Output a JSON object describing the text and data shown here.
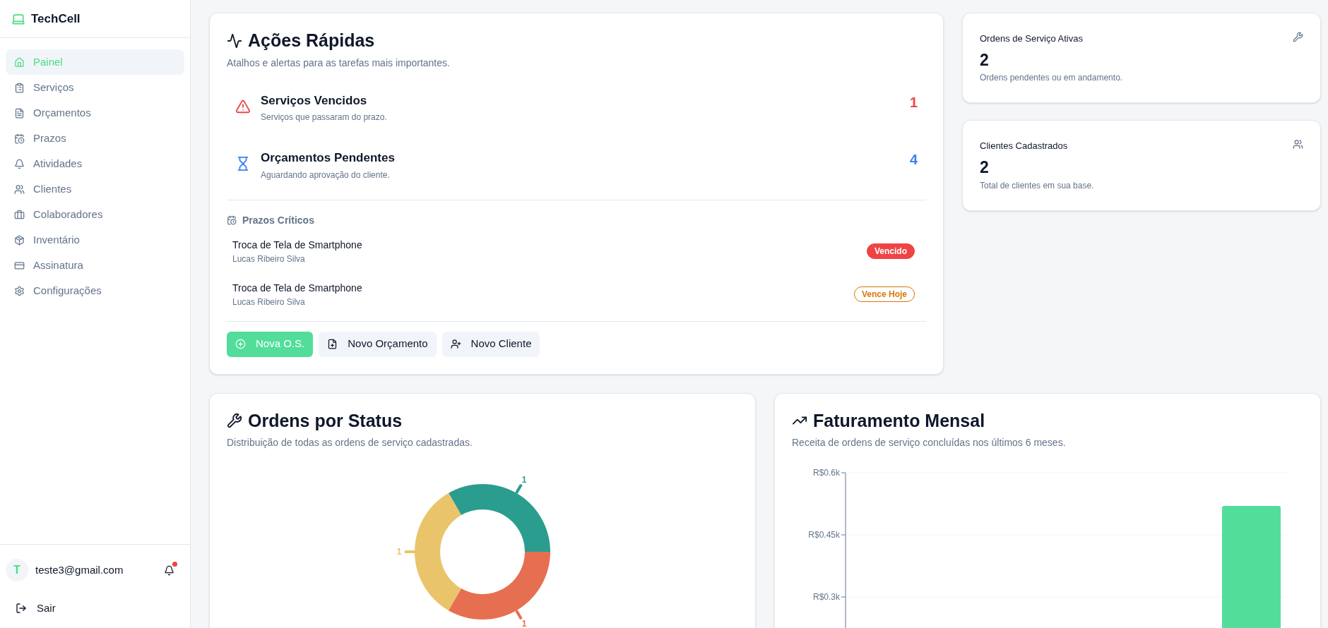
{
  "sidebar": {
    "brand": "TechCell",
    "items": [
      {
        "label": "Painel",
        "selected": true
      },
      {
        "label": "Serviços",
        "selected": false
      },
      {
        "label": "Orçamentos",
        "selected": false
      },
      {
        "label": "Prazos",
        "selected": false
      },
      {
        "label": "Atividades",
        "selected": false
      },
      {
        "label": "Clientes",
        "selected": false
      },
      {
        "label": "Colaboradores",
        "selected": false
      },
      {
        "label": "Inventário",
        "selected": false
      },
      {
        "label": "Assinatura",
        "selected": false
      },
      {
        "label": "Configurações",
        "selected": false
      }
    ],
    "user": {
      "initial": "T",
      "email": "teste3@gmail.com",
      "has_notification": true
    },
    "logout": "Sair"
  },
  "quick_actions": {
    "title": "Ações Rápidas",
    "subtitle": "Atalhos e alertas para as tarefas mais importantes.",
    "alerts": [
      {
        "kind": "danger",
        "title": "Serviços Vencidos",
        "description": "Serviços que passaram do prazo.",
        "count": "1"
      },
      {
        "kind": "info",
        "title": "Orçamentos Pendentes",
        "description": "Aguardando aprovação do cliente.",
        "count": "4"
      }
    ],
    "deadlines": {
      "title": "Prazos Críticos",
      "items": [
        {
          "service": "Troca de Tela de Smartphone",
          "client": "Lucas Ribeiro Silva",
          "status": "Vencido",
          "kind": "overdue"
        },
        {
          "service": "Troca de Tela de Smartphone",
          "client": "Lucas Ribeiro Silva",
          "status": "Vence Hoje",
          "kind": "today"
        }
      ]
    },
    "buttons": [
      {
        "label": "Nova O.S.",
        "kind": "primary"
      },
      {
        "label": "Novo Orçamento",
        "kind": "secondary"
      },
      {
        "label": "Novo Cliente",
        "kind": "secondary"
      }
    ]
  },
  "stats": [
    {
      "title": "Ordens de Serviço Ativas",
      "value": "2",
      "description": "Ordens pendentes ou em andamento."
    },
    {
      "title": "Clientes Cadastrados",
      "value": "2",
      "description": "Total de clientes em sua base."
    }
  ],
  "status_chart": {
    "title": "Ordens por Status",
    "subtitle": "Distribuição de todas as ordens de serviço cadastradas.",
    "chart_data": {
      "type": "donut",
      "values": [
        1,
        1,
        1
      ],
      "colors": [
        "#2a9d8f",
        "#e9c46a",
        "#e76f51"
      ],
      "data_labels": true
    }
  },
  "revenue_chart": {
    "title": "Faturamento Mensal",
    "subtitle": "Receita de ordens de serviço concluídas nos últimos 6 meses.",
    "axis_labels": [
      "R$0.6k",
      "R$0.45k",
      "R$0.3k"
    ]
  }
}
